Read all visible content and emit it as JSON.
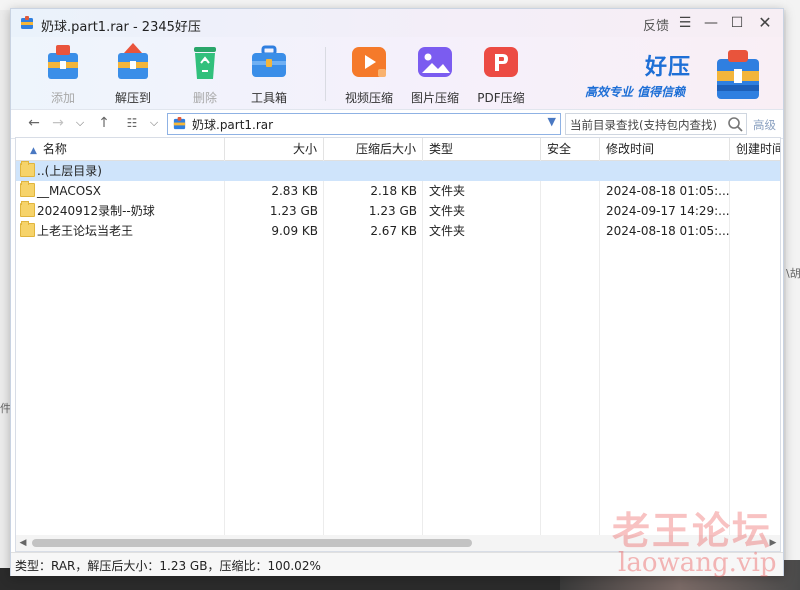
{
  "window": {
    "title": "奶球.part1.rar - 2345好压",
    "feedback": "反馈"
  },
  "toolbar": {
    "tools": [
      {
        "label": "添加",
        "icon": "add-archive-icon",
        "enabled": false
      },
      {
        "label": "解压到",
        "icon": "extract-to-icon",
        "enabled": true
      },
      {
        "label": "删除",
        "icon": "recycle-delete-icon",
        "enabled": false
      },
      {
        "label": "工具箱",
        "icon": "toolbox-icon",
        "enabled": true
      },
      {
        "label": "视频压缩",
        "icon": "video-compress-icon",
        "enabled": true
      },
      {
        "label": "图片压缩",
        "icon": "image-compress-icon",
        "enabled": true
      },
      {
        "label": "PDF压缩",
        "icon": "pdf-compress-icon",
        "enabled": true
      }
    ],
    "brand": {
      "name": "好压",
      "slogan": "高效专业  值得信赖"
    }
  },
  "addressbar": {
    "path": "奶球.part1.rar",
    "search_placeholder": "当前目录查找(支持包内查找)",
    "advanced": "高级"
  },
  "table": {
    "columns": [
      "名称",
      "大小",
      "压缩后大小",
      "类型",
      "安全",
      "修改时间",
      "创建时间"
    ],
    "rows": [
      {
        "name": "..(上层目录)",
        "size": "",
        "packed": "",
        "type": "",
        "security": "",
        "modified": "",
        "created": "",
        "selected": true
      },
      {
        "name": "__MACOSX",
        "size": "2.83 KB",
        "packed": "2.18 KB",
        "type": "文件夹",
        "security": "",
        "modified": "2024-08-18 01:05:...",
        "created": ""
      },
      {
        "name": "20240912录制--奶球",
        "size": "1.23 GB",
        "packed": "1.23 GB",
        "type": "文件夹",
        "security": "",
        "modified": "2024-09-17 14:29:...",
        "created": ""
      },
      {
        "name": "上老王论坛当老王",
        "size": "9.09 KB",
        "packed": "2.67 KB",
        "type": "文件夹",
        "security": "",
        "modified": "2024-08-18 01:05:...",
        "created": ""
      }
    ]
  },
  "status": {
    "text": "类型：RAR，解压后大小：1.23 GB，压缩比：100.02%"
  },
  "watermark": {
    "line1": "老王论坛",
    "line2": "laowang.vip"
  },
  "background": {
    "frag_right": "\\胡",
    "frag_left": "件"
  },
  "colors": {
    "accent": "#1e6fd6",
    "selection": "#cfe4fb",
    "watermark": "#eb4646"
  }
}
